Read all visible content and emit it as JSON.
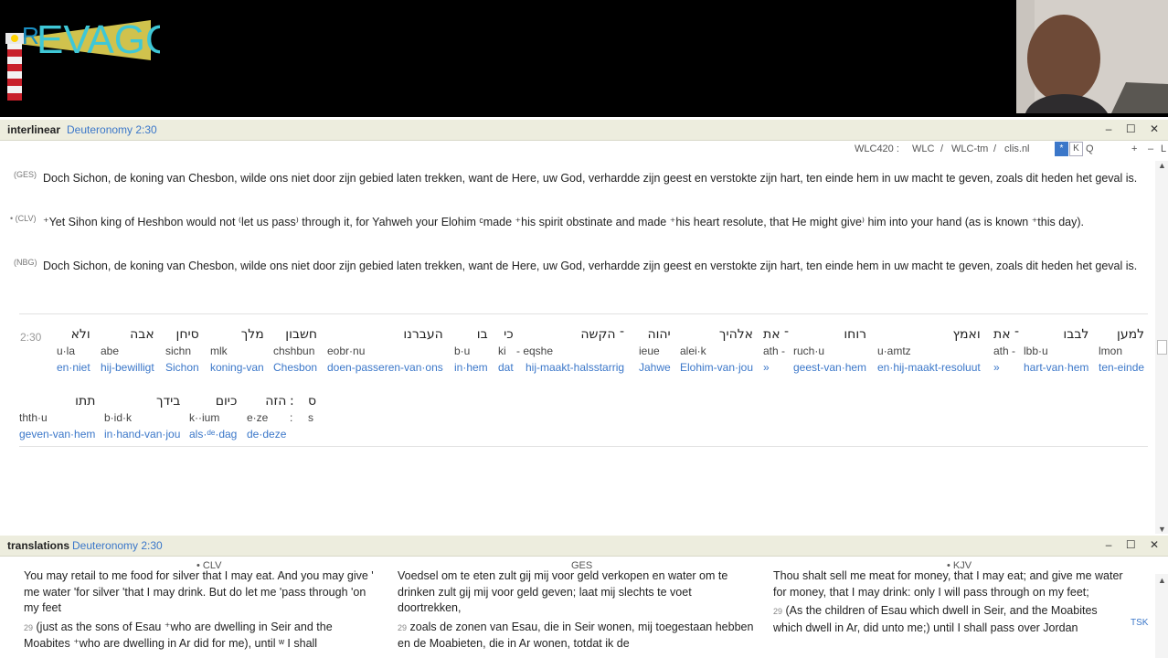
{
  "brand": {
    "logo_text": "REVAGO",
    "logo_prefix": "R",
    "logo_rest": "EVAGO"
  },
  "interlinear": {
    "panel_name": "interlinear",
    "reference": "Deuteronomy 2:30",
    "window_controls": [
      "–",
      "☐",
      "✕"
    ],
    "sources": [
      "WLC420 :",
      "WLC",
      "/",
      "WLC-tm",
      "/",
      "clis.nl"
    ],
    "toggles": [
      "*",
      "K",
      "Q"
    ],
    "extra_controls": [
      "+",
      "–",
      "L"
    ],
    "verses": [
      {
        "label": "(GES)",
        "text": "Doch Sichon, de koning van Chesbon, wilde ons niet door zijn gebied laten trekken, want de Here, uw God, verhardde zijn geest en verstokte zijn hart, ten einde hem in uw macht te geven, zoals dit heden het geval is."
      },
      {
        "label": "• (CLV)",
        "text": "⁺Yet Sihon king of Heshbon would not ⁽let us pass⁾ through it, for Yahweh your Elohim ᶜmade ⁺his spirit obstinate and made ⁺his heart resolute, that He might give⁾ him into your hand (as is known ⁺this day)."
      },
      {
        "label": "(NBG)",
        "text": "Doch Sichon, de koning van Chesbon, wilde ons niet door zijn gebied laten trekken, want de Here, uw God, verhardde zijn geest en verstokte zijn hart, ten einde hem in uw macht te geven, zoals dit heden het geval is."
      }
    ],
    "verse_ref": "2:30",
    "words": [
      {
        "heb": "ולא",
        "tr": "u·la",
        "gl": "en·niet"
      },
      {
        "heb": "אבה",
        "tr": "abe",
        "gl": "hij-bewilligt"
      },
      {
        "heb": "סיחן",
        "tr": "sichn",
        "gl": "Sichon"
      },
      {
        "heb": "מלך",
        "tr": "mlk",
        "gl": "koning-van"
      },
      {
        "heb": "חשבון",
        "tr": "chshbun",
        "gl": "Chesbon"
      },
      {
        "heb": "העברנו",
        "tr": "eobr·nu",
        "gl": "doen-passeren-van·ons"
      },
      {
        "heb": "בו",
        "tr": "b·u",
        "gl": "in·hem"
      },
      {
        "heb": "כי",
        "tr": "ki",
        "gl": "dat"
      },
      {
        "heb": "־ הקשה",
        "tr": "- eqshe",
        "gl": "hij-maakt-halsstarrig"
      },
      {
        "heb": "יהוה",
        "tr": "ieue",
        "gl": "Jahwe"
      },
      {
        "heb": "אלהיך",
        "tr": "alei·k",
        "gl": "Elohim-van·jou"
      },
      {
        "heb": "־ את",
        "tr": "ath -",
        "gl": "»"
      },
      {
        "heb": "רוחו",
        "tr": "ruch·u",
        "gl": "geest-van·hem"
      },
      {
        "heb": "ואמץ",
        "tr": "u·amtz",
        "gl": "en·hij-maakt-resoluut"
      },
      {
        "heb": "־ את",
        "tr": "ath -",
        "gl": "»"
      },
      {
        "heb": "לבבו",
        "tr": "lbb·u",
        "gl": "hart-van·hem"
      },
      {
        "heb": "למען",
        "tr": "lmon",
        "gl": "ten-einde"
      },
      {
        "heb": "תתו",
        "tr": "thth·u",
        "gl": "geven-van·hem"
      },
      {
        "heb": "בידך",
        "tr": "b·id·k",
        "gl": "in·hand-van·jou"
      },
      {
        "heb": "כיום",
        "tr": "k··ium",
        "gl": "als·ᵈᵉ·dag"
      },
      {
        "heb": "הזה",
        "tr": "e·ze",
        "gl": "de·deze"
      },
      {
        "heb": ":",
        "tr": ":",
        "gl": ""
      },
      {
        "heb": "ס",
        "tr": "s",
        "gl": ""
      }
    ]
  },
  "translations": {
    "panel_name": "translations",
    "reference": "Deuteronomy 2:30",
    "columns": [
      "• CLV",
      "GES",
      "• KJV"
    ],
    "side_tag": "TSK",
    "clv": {
      "line1": "You may retail to me food for silver that I may eat. And you may give ' me water 'for silver 'that I may drink. But do let me 'pass through 'on my feet",
      "vnum": "29",
      "line2": "(just as the sons of Esau ⁺who are dwelling in Seir and the Moabites ⁺who are dwelling in Ar did for me), until ʷ I shall"
    },
    "ges": {
      "line1": "Voedsel om te eten zult gij mij voor geld verkopen en water om te drinken zult gij mij voor geld geven; laat mij slechts te voet doortrekken,",
      "vnum": "29",
      "line2": "zoals de zonen van Esau, die in Seir wonen, mij toegestaan hebben en de Moabieten, die in Ar wonen, totdat ik de"
    },
    "kjv": {
      "line1": "Thou shalt sell me meat for money, that I may eat; and give me water for money, that I may drink: only I will pass through on my feet;",
      "vnum": "29",
      "line2": "(As the children of Esau which dwell in Seir, and the Moabites which dwell in Ar, did unto me;) until I shall pass over Jordan"
    }
  }
}
